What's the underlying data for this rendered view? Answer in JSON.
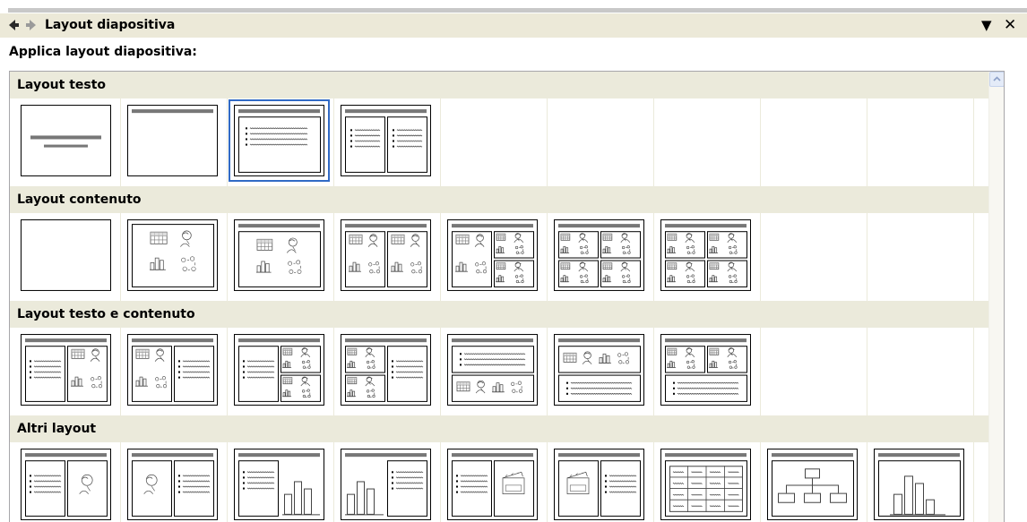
{
  "pane": {
    "title": "Layout diapositiva",
    "heading": "Applica layout diapositiva:"
  },
  "sections": [
    {
      "name": "Layout testo",
      "layouts": [
        "title",
        "title-only",
        "title-text",
        "title-2col-text",
        "empty",
        "empty",
        "empty",
        "empty",
        "empty"
      ],
      "selected_index": 2
    },
    {
      "name": "Layout contenuto",
      "layouts": [
        "blank",
        "content-big",
        "title-content",
        "title-2content",
        "title-content-4small",
        "title-4content-grid",
        "title-4content-grid",
        "empty",
        "empty"
      ]
    },
    {
      "name": "Layout testo e contenuto",
      "layouts": [
        "text-left-content-right",
        "content-left-text-right",
        "text-left-2content-right",
        "2content-left-text-right",
        "text-top-content-bottom",
        "content-top-text-bottom",
        "2content-top-text-bottom",
        "empty",
        "empty"
      ]
    },
    {
      "name": "Altri layout",
      "layouts": [
        "text-left-clipart-right",
        "clipart-left-text-right",
        "text-left-chart-right",
        "chart-left-text-right",
        "text-left-media-right",
        "media-left-text-right",
        "title-table",
        "title-diagram",
        "title-chart"
      ]
    }
  ],
  "colors": {
    "selection": "#316ac5",
    "section_bg": "#ebeadb",
    "titlebar_bg": "#ece9d8"
  }
}
